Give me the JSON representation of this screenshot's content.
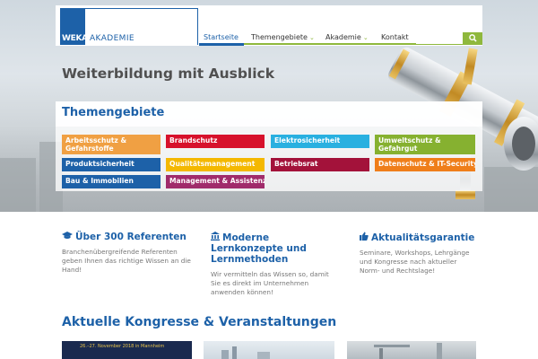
{
  "brand": {
    "logo_mark": "WEKA",
    "logo_text": "AKADEMIE"
  },
  "nav": {
    "items": [
      {
        "label": "Startseite",
        "active": true,
        "has_dropdown": false
      },
      {
        "label": "Themengebiete",
        "active": false,
        "has_dropdown": true
      },
      {
        "label": "Akademie",
        "active": false,
        "has_dropdown": true
      },
      {
        "label": "Kontakt",
        "active": false,
        "has_dropdown": false
      }
    ],
    "search_placeholder": "",
    "search_icon": "search-icon"
  },
  "hero": {
    "title": "Weiterbildung mit Ausblick"
  },
  "topics": {
    "title": "Themengebiete",
    "tiles": [
      {
        "label": "Arbeitsschutz & Gefahrstoffe",
        "color": "#f0a043"
      },
      {
        "label": "Brandschutz",
        "color": "#d7112b"
      },
      {
        "label": "Elektrosicherheit",
        "color": "#29b0e0"
      },
      {
        "label": "Umweltschutz & Gefahrgut",
        "color": "#86b130"
      },
      {
        "label": "Produktsicherheit",
        "color": "#1d61a8"
      },
      {
        "label": "Qualitätsmanagement",
        "color": "#f4b800"
      },
      {
        "label": "Betriebsrat",
        "color": "#a3123a"
      },
      {
        "label": "Datenschutz & IT-Security",
        "color": "#ef7e1a"
      },
      {
        "label": "Bau & Immobilien",
        "color": "#1d61a8"
      },
      {
        "label": "Management & Assistenz",
        "color": "#a02b6b"
      }
    ]
  },
  "features": [
    {
      "icon": "graduation-cap-icon",
      "title": "Über 300 Referenten",
      "text": "Branchenübergreifende Referenten geben Ihnen das richtige Wissen an die Hand!"
    },
    {
      "icon": "institution-icon",
      "title": "Moderne Lernkonzepte und Lernmethoden",
      "text": "Wir vermitteln das Wissen so, damit Sie es direkt im Unternehmen anwenden können!"
    },
    {
      "icon": "thumbs-up-icon",
      "title": "Aktualitätsgarantie",
      "text": "Seminare, Workshops, Lehrgänge und Kongresse nach aktueller Norm- und Rechtslage!"
    }
  ],
  "events": {
    "title": "Aktuelle Kongresse & Veranstaltungen",
    "thumb_caption": "26.–27. November 2018 in Mannheim"
  }
}
